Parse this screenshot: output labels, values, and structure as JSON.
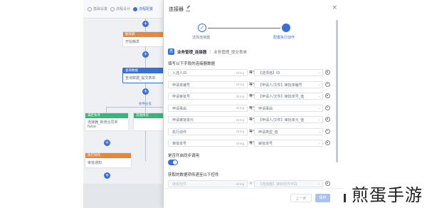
{
  "canvas": {
    "tabs": [
      {
        "label": "基础设置",
        "active": false
      },
      {
        "label": "流程设计",
        "active": false
      },
      {
        "label": "流程配置",
        "active": true
      }
    ],
    "nodes": {
      "trigger": {
        "header": "触发器",
        "body": "开始触发"
      },
      "query": {
        "header": "查询数据",
        "body": "查询数据_提交表单"
      },
      "branch_label": "条件分支",
      "branch_left": {
        "header": "满足条件",
        "body": "连接器_新增合同单",
        "sub": "false"
      },
      "branch_right": {
        "header": "其他情况",
        "body": ""
      },
      "end": {
        "header": "执行动作",
        "body": "审批通知"
      }
    }
  },
  "drawer": {
    "title": "连接器",
    "close": "×",
    "steps": [
      {
        "label": "选择连接器",
        "done": true,
        "mark": "✓"
      },
      {
        "label": "配置执行动作",
        "active": true
      }
    ],
    "connector": {
      "badge": "连",
      "name": "业务管理_连接器",
      "sep": "|",
      "operation": "业务管理_提交表单"
    },
    "section_fill": "填写以下字段的连接器数据",
    "fields": [
      {
        "required": true,
        "name": "入选人ID",
        "type": "string",
        "op": "等于",
        "value": "【选项值】ID"
      },
      {
        "required": true,
        "name": "申请单编号",
        "type": "string",
        "op": "等于",
        "value": "【申请人/文件】审批单编号"
      },
      {
        "required": true,
        "name": "申请审批号",
        "type": "string",
        "op": "等于",
        "value": "【申请人/文件】审批单号_值"
      },
      {
        "required": true,
        "name": "申请事由",
        "type": "string",
        "op": "等于",
        "value": "申请事由"
      },
      {
        "required": true,
        "name": "申请审批单元",
        "type": "string",
        "op": "等于",
        "value": "【申请人/文件】审批单元_值"
      },
      {
        "required": true,
        "name": "执行动作",
        "type": "string",
        "op": "等于",
        "value": "申请类型_值"
      },
      {
        "required": true,
        "name": "审批单号",
        "type": "string",
        "op": "等于",
        "value": "审批单号"
      }
    ],
    "sync_label": "是否开启同步调用",
    "sync_on": true,
    "section_return": "获取的数据项传递至以下控件",
    "return_row": {
      "name": "接受控件",
      "type": "string",
      "op": "等于",
      "value": "【连接器】接收控件字段"
    },
    "footer": {
      "prev": "上一步",
      "save": "保存"
    }
  },
  "watermark": "煎蛋手游",
  "colors": {
    "accent": "#3a6fd8",
    "orange": "#e8863a",
    "green": "#39b57a"
  }
}
